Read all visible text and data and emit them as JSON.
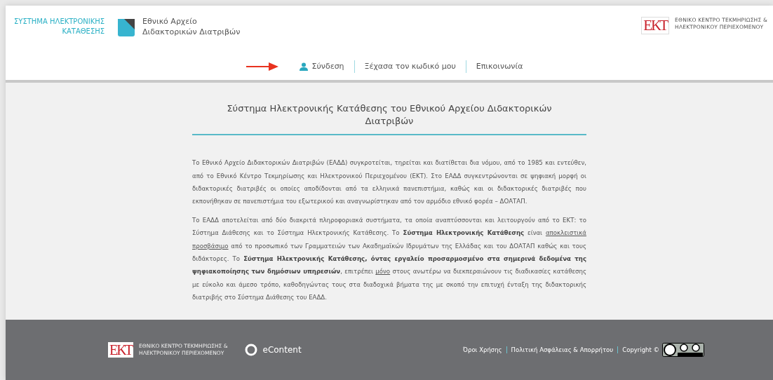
{
  "header": {
    "system_name": [
      "ΣΥΣΤΗΜΑ ΗΛΕΚΤΡΟΝΙΚΗΣ",
      "ΚΑΤΑΘΕΣΗΣ"
    ],
    "archive_name": [
      "Εθνικό Αρχείο",
      "Διδακτορικών Διατριβών"
    ],
    "ekt_logo": {
      "mark": "ΕΚΤ",
      "lines": [
        "ΕΘΝΙΚΟ ΚΕΝΤΡΟ ΤΕΚΜΗΡΙΩΣΗΣ &",
        "ΗΛΕΚΤΡΟΝΙΚΟΥ ΠΕΡΙΕΧΟΜΕΝΟΥ"
      ]
    }
  },
  "nav": [
    {
      "label": "Σύνδεση",
      "kind": "user",
      "pointed": true
    },
    {
      "label": "Ξέχασα τον κωδικό μου",
      "kind": "plain",
      "pointed": false
    },
    {
      "label": "Επικοινωνία",
      "kind": "plain",
      "pointed": false
    }
  ],
  "content": {
    "title": "Σύστημα Ηλεκτρονικής Κατάθεσης του Εθνικού Αρχείου Διδακτορικών Διατριβών",
    "paragraphs": [
      [
        {
          "kind": "plain",
          "text": "Το Εθνικό Αρχείο Διδακτορικών Διατριβών (ΕΑΔΔ) συγκροτείται, τηρείται και διατίθεται δια νόμου, από το 1985 και εντεύθεν, από το Εθνικό Κέντρο Τεκμηρίωσης και Ηλεκτρονικού Περιεχομένου (ΕΚΤ). Στο ΕΑΔΔ συγκεντρώνονται σε ψηφιακή μορφή οι διδακτορικές διατριβές οι οποίες αποδίδονται από τα ελληνικά πανεπιστήμια, καθώς και οι διδακτορικές διατριβές που εκπονήθηκαν σε πανεπιστήμια του εξωτερικού και αναγνωρίστηκαν από τον αρμόδιο εθνικό φορέα – ΔΟΑΤΑΠ."
        }
      ],
      [
        {
          "kind": "plain",
          "text": "Το ΕΑΔΔ αποτελείται από δύο διακριτά πληροφοριακά συστήματα, τα οποία αναπτύσσονται και λειτουργούν από το ΕΚΤ: το Σύστημα Διάθεσης και το Σύστημα Ηλεκτρονικής Κατάθεσης. Το "
        },
        {
          "kind": "bold",
          "text": "Σύστημα Ηλεκτρονικής Κατάθεσης"
        },
        {
          "kind": "plain",
          "text": " είναι "
        },
        {
          "kind": "underline",
          "text": "αποκλειστικά προσβάσιμο"
        },
        {
          "kind": "plain",
          "text": " από το προσωπικό των Γραμματειών των Ακαδημαϊκών Ιδρυμάτων της Ελλάδας και του ΔΟΑΤΑΠ καθώς και τους διδάκτορες. Το "
        },
        {
          "kind": "bold",
          "text": "Σύστημα Ηλεκτρονικής Κατάθεσης, όντας εργαλείο προσαρμοσμένο στα σημερινά δεδομένα της ψηφιακοποίησης των δημόσιων υπηρεσιών"
        },
        {
          "kind": "plain",
          "text": ", επιτρέπει "
        },
        {
          "kind": "underline",
          "text": "μόνο"
        },
        {
          "kind": "plain",
          "text": " στους ανωτέρω να διεκπεραιώνουν τις διαδικασίες κατάθεσης με εύκολο και άμεσο τρόπο, καθοδηγώντας τους στα διαδοχικά βήματα της με σκοπό την επιτυχή ένταξη της διδακτορικής διατριβής στο Σύστημα Διάθεσης του ΕΑΔΔ."
        }
      ]
    ]
  },
  "footer": {
    "ekt_logo": {
      "mark": "ΕΚΤ",
      "lines": [
        "ΕΘΝΙΚΟ ΚΕΝΤΡΟ ΤΕΚΜΗΡΙΩΣΗΣ &",
        "ΗΛΕΚΤΡΟΝΙΚΟΥ ΠΕΡΙΕΧΟΜΕΝΟΥ"
      ]
    },
    "econtent": "eContent",
    "links": [
      "Όροι Χρήσης",
      "Πολιτική Ασφάλειας & Απορρήτου",
      "Copyright ©"
    ]
  }
}
